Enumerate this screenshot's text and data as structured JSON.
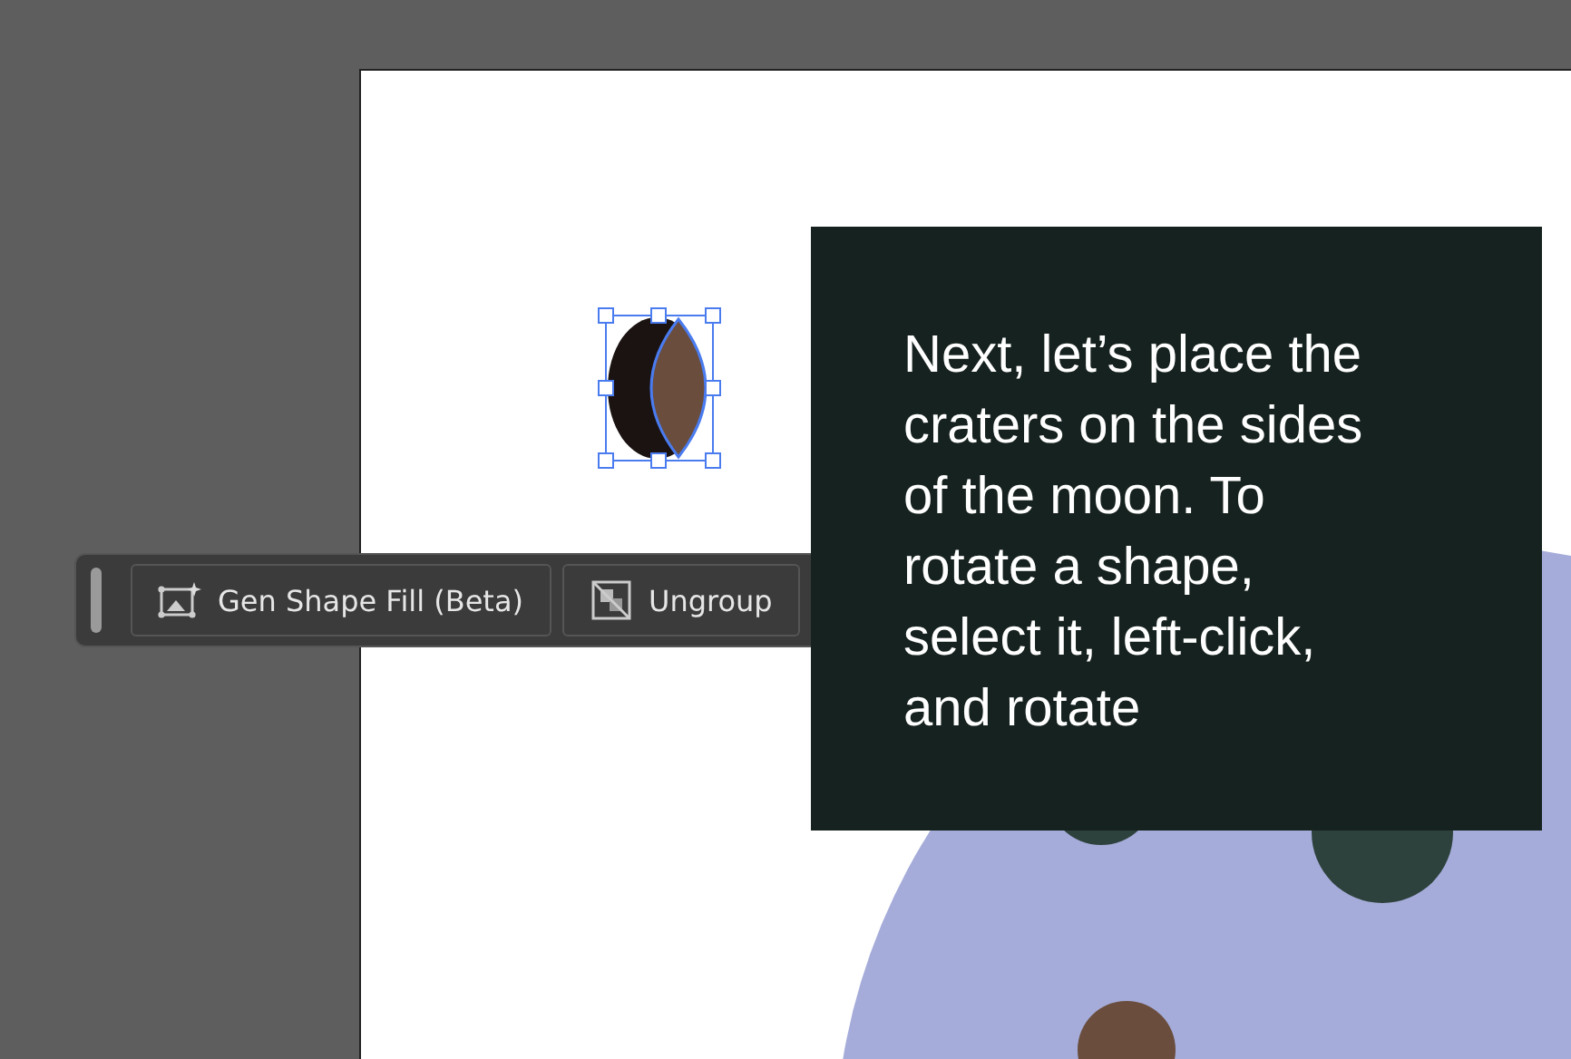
{
  "toolbar": {
    "buttons": [
      {
        "kind": "gen-fill",
        "label": "Gen Shape Fill (Beta)"
      },
      {
        "kind": "ungroup",
        "label": "Ungroup"
      }
    ]
  },
  "tooltip": {
    "text": "Next, let’s place the\ncraters on the sides\nof the moon. To\nrotate a shape,\nselect it, left-click,\nand rotate"
  }
}
